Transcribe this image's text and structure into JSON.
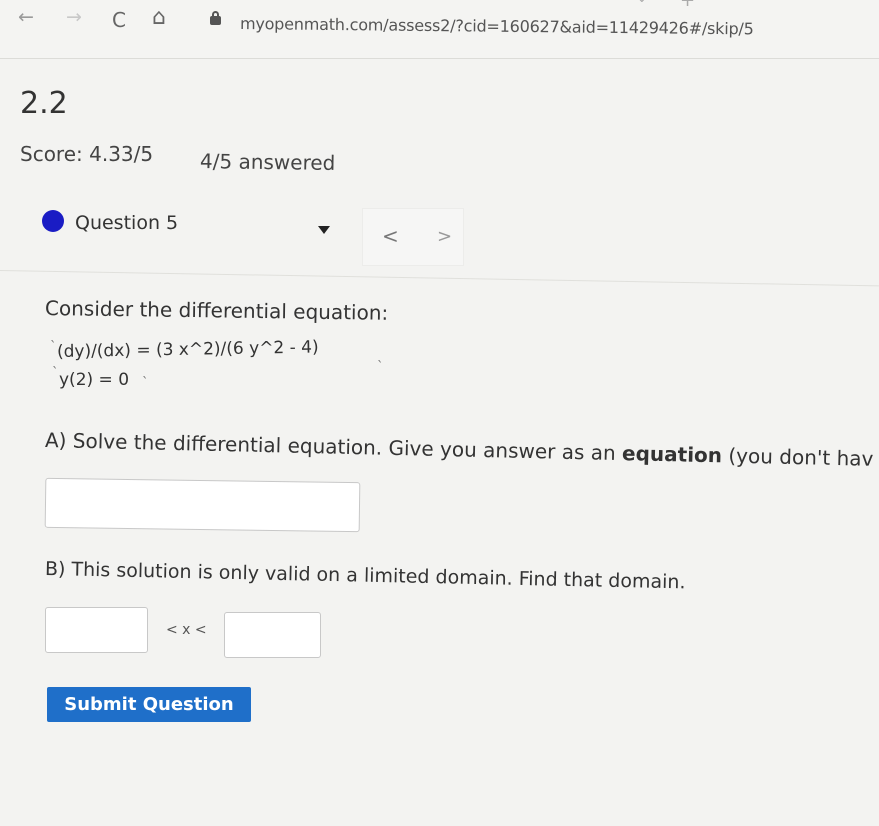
{
  "browser": {
    "back": "←",
    "forward": "→",
    "reload": "C",
    "home": "⌂",
    "url": "myopenmath.com/assess2/?cid=160627&aid=11429426#/skip/5"
  },
  "assessment": {
    "title": "2.2",
    "score": "Score: 4.33/5",
    "answered": "4/5 answered"
  },
  "question_nav": {
    "label": "Question 5",
    "prev": "<",
    "next": ">"
  },
  "question": {
    "prompt": "Consider the differential equation:",
    "equation": "(dy)/(dx) = (3 x^2)/(6 y^2 - 4)",
    "initial_condition": "y(2) = 0",
    "part_a_pre": "A) Solve the differential equation. Give you answer as an ",
    "part_a_bold": "equation",
    "part_a_post": " (you don't hav",
    "part_b": "B) This solution is only valid on a limited domain. Find that domain.",
    "domain_separator": "< x <",
    "submit_label": "Submit Question"
  },
  "colors": {
    "question_dot": "#1a1cc4",
    "submit_button": "#1f6fc9"
  }
}
